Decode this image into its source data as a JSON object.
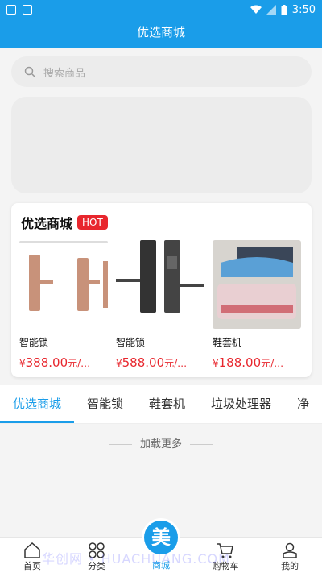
{
  "status": {
    "time": "3:50"
  },
  "header": {
    "title": "优选商城"
  },
  "search": {
    "placeholder": "搜索商品"
  },
  "hot": {
    "title": "优选商城",
    "badge": "HOT",
    "products": [
      {
        "name": "智能锁",
        "currency": "¥",
        "price": "388.00",
        "unit": "元/…"
      },
      {
        "name": "智能锁",
        "currency": "¥",
        "price": "588.00",
        "unit": "元/…"
      },
      {
        "name": "鞋套机",
        "currency": "¥",
        "price": "188.00",
        "unit": "元/…"
      }
    ]
  },
  "tabs": [
    "优选商城",
    "智能锁",
    "鞋套机",
    "垃圾处理器",
    "净"
  ],
  "load_more": "加载更多",
  "bottom_nav": {
    "home": "首页",
    "category": "分类",
    "mall": "商城",
    "mall_badge": "美",
    "cart": "购物车",
    "mine": "我的"
  },
  "watermark": "华创网 • HUACHUANG.COM",
  "colors": {
    "primary": "#1a9de9",
    "hot": "#e8262d",
    "price": "#e8262d"
  }
}
